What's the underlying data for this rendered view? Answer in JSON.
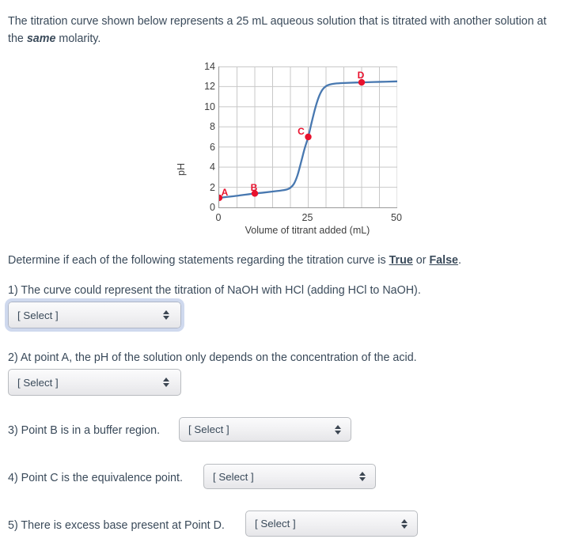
{
  "intro": {
    "part1": "The titration curve shown below represents a 25 mL aqueous solution that is titrated with another solution at the ",
    "emphasis": "same",
    "part2": " molarity."
  },
  "chart_data": {
    "type": "line",
    "title": "",
    "xlabel": "Volume of titrant added (mL)",
    "ylabel": "pH",
    "xlim": [
      0,
      50
    ],
    "ylim": [
      0,
      14
    ],
    "xticks": [
      0,
      25,
      50
    ],
    "xtick_labels": [
      "0",
      "25",
      "50"
    ],
    "yticks": [
      0,
      2,
      4,
      6,
      8,
      10,
      12,
      14
    ],
    "ytick_labels": [
      "0",
      "2",
      "4",
      "6",
      "8",
      "10",
      "12",
      "14"
    ],
    "x_minor_step": 5,
    "grid": true,
    "legend": "none",
    "series": [
      {
        "name": "titration curve",
        "color": "#4878b0",
        "x": [
          0,
          2.5,
          5,
          7.5,
          10,
          12.5,
          15,
          17.5,
          19,
          20,
          21,
          22,
          23,
          24,
          25,
          26,
          27,
          28,
          29,
          30,
          31,
          32.5,
          35,
          40,
          45,
          50
        ],
        "y": [
          0.95,
          1.05,
          1.15,
          1.27,
          1.38,
          1.47,
          1.57,
          1.68,
          1.78,
          1.95,
          2.35,
          3.2,
          4.5,
          5.85,
          7.0,
          8.5,
          9.9,
          11.0,
          11.7,
          12.05,
          12.2,
          12.3,
          12.36,
          12.42,
          12.47,
          12.52
        ]
      }
    ],
    "annotations": [
      {
        "label": "A",
        "x": 0,
        "y": 0.95,
        "color": "#e8112d"
      },
      {
        "label": "B",
        "x": 10,
        "y": 1.38,
        "color": "#e8112d"
      },
      {
        "label": "C",
        "x": 25,
        "y": 7.0,
        "color": "#e8112d"
      },
      {
        "label": "D",
        "x": 40,
        "y": 12.42,
        "color": "#e8112d"
      }
    ]
  },
  "determine": {
    "before": "Determine if each of the following statements regarding the titration curve is ",
    "true_label": "True",
    "middle": " or ",
    "false_label": "False",
    "after": "."
  },
  "questions": [
    {
      "text": "1) The curve could represent the titration of NaOH with HCl (adding HCl to NaOH).",
      "select_value": "[ Select ]",
      "layout": "block",
      "focused": true
    },
    {
      "text": "2) At point A, the pH of the solution only depends on the concentration of the acid.",
      "select_value": "[ Select ]",
      "layout": "block",
      "focused": false
    },
    {
      "text": "3) Point B is in a buffer region.",
      "select_value": "[ Select ]",
      "layout": "inline",
      "focused": false
    },
    {
      "text": "4) Point C is the equivalence point.",
      "select_value": "[ Select ]",
      "layout": "inline",
      "focused": false
    },
    {
      "text": "5) There is excess base present at Point D.",
      "select_value": "[ Select ]",
      "layout": "inline",
      "focused": false
    }
  ]
}
